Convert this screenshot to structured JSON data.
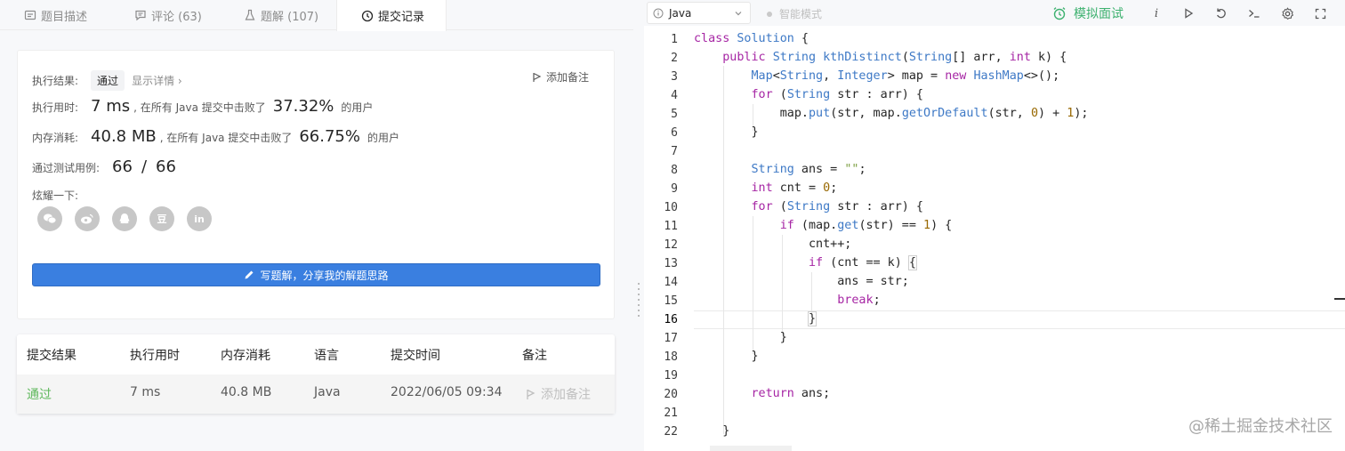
{
  "tabs": [
    {
      "label": "题目描述",
      "icon": "description-icon"
    },
    {
      "label": "评论 (63)",
      "icon": "comment-icon"
    },
    {
      "label": "题解 (107)",
      "icon": "flask-icon"
    },
    {
      "label": "提交记录",
      "icon": "clock-icon",
      "active": true
    }
  ],
  "result": {
    "label": "执行结果:",
    "status": "通过",
    "detail_link": "显示详情 ›",
    "note_btn": "添加备注",
    "time_label": "执行用时:",
    "time_value": "7 ms",
    "time_mid": ", 在所有 Java 提交中击败了",
    "time_pct": "37.32%",
    "users": "的用户",
    "mem_label": "内存消耗:",
    "mem_value": "40.8 MB",
    "mem_mid": ", 在所有 Java 提交中击败了",
    "mem_pct": "66.75%",
    "cases_label": "通过测试用例:",
    "cases_passed": "66",
    "cases_sep": "/",
    "cases_total": "66",
    "share_label": "炫耀一下:",
    "share_icons": [
      "wechat-icon",
      "weibo-icon",
      "qq-icon",
      "douban-icon",
      "linkedin-icon"
    ],
    "share_glyphs": [
      "",
      "",
      "",
      "豆",
      "in"
    ],
    "write_btn": "写题解，分享我的解题思路"
  },
  "table": {
    "headers": [
      "提交结果",
      "执行用时",
      "内存消耗",
      "语言",
      "提交时间",
      "备注"
    ],
    "row": {
      "result": "通过",
      "time": "7 ms",
      "memory": "40.8 MB",
      "language": "Java",
      "submitted": "2022/06/05 09:34",
      "note": "添加备注"
    }
  },
  "editor": {
    "language": "Java",
    "smart_mode": "智能模式",
    "mock_interview": "模拟面试",
    "tools": [
      "info-icon",
      "run-icon",
      "reset-icon",
      "console-icon",
      "settings-icon",
      "fullscreen-icon"
    ],
    "info_glyph": "i",
    "line_numbers": [
      "1",
      "2",
      "3",
      "4",
      "5",
      "6",
      "7",
      "8",
      "9",
      "10",
      "11",
      "12",
      "13",
      "14",
      "15",
      "16",
      "17",
      "18",
      "19",
      "20",
      "21",
      "22"
    ],
    "current_line": 16
  },
  "watermark": "@稀土掘金技术社区",
  "colors": {
    "accent_green": "#3db16f",
    "pass_green": "#5fb85c",
    "button_blue": "#3a7fe0"
  }
}
